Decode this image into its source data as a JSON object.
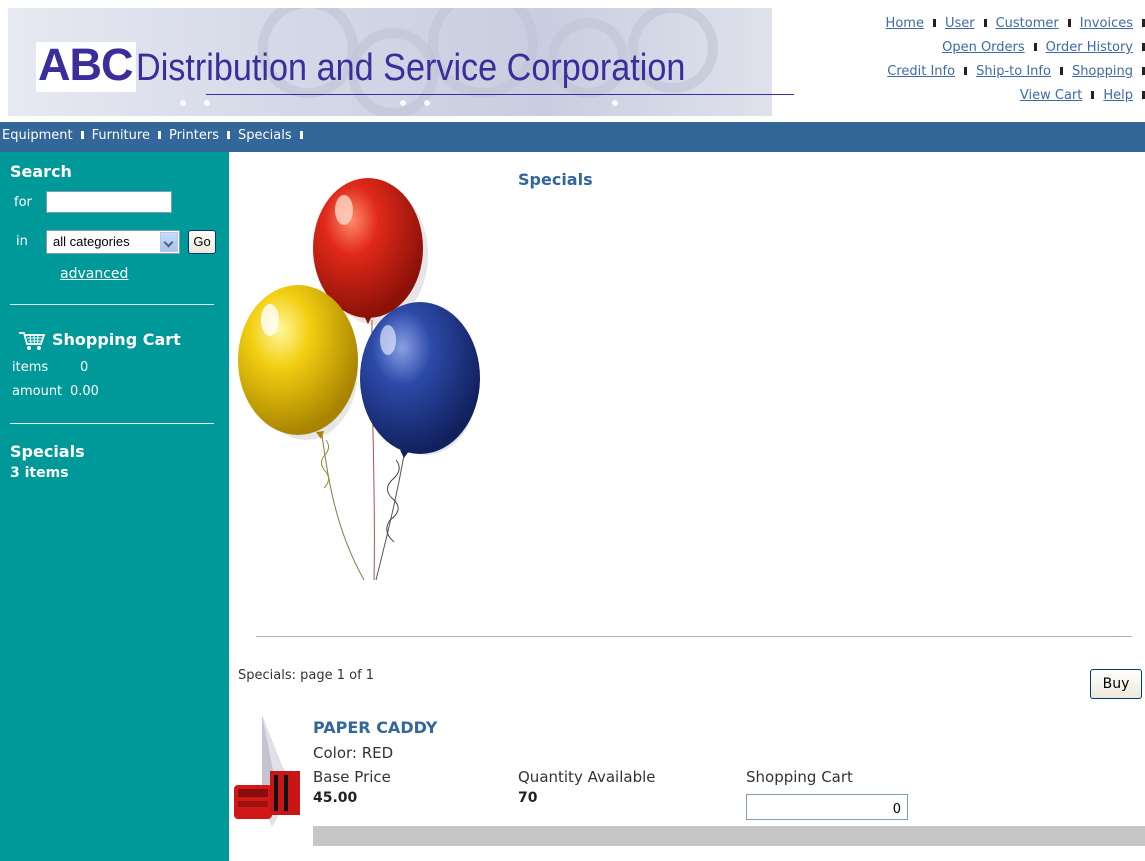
{
  "header": {
    "logo_abc": "ABC",
    "logo_rest": "Distribution and Service Corporation",
    "links": {
      "home": "Home",
      "user": "User",
      "customer": "Customer",
      "invoices": "Invoices",
      "open_orders": "Open Orders",
      "order_history": "Order History",
      "credit_info": "Credit Info",
      "ship_to_info": "Ship-to Info",
      "shopping": "Shopping",
      "view_cart": "View Cart",
      "help": "Help"
    }
  },
  "nav": {
    "equipment": "Equipment",
    "furniture": "Furniture",
    "printers": "Printers",
    "specials": "Specials"
  },
  "sidebar": {
    "search": {
      "title": "Search",
      "for_label": "for",
      "for_value": "",
      "in_label": "in",
      "category_selected": "all categories",
      "go_label": "Go",
      "advanced_label": "advanced"
    },
    "cart": {
      "title": "Shopping Cart",
      "items_label": "items",
      "items_value": "0",
      "amount_label": "amount",
      "amount_value": "0.00"
    },
    "specials": {
      "title": "Specials",
      "count": "3 items"
    }
  },
  "main": {
    "title": "Specials",
    "pagination": "Specials: page 1 of 1",
    "buy_label": "Buy",
    "product": {
      "name": "PAPER CADDY",
      "color": "Color: RED",
      "base_price_label": "Base Price",
      "base_price_value": "45.00",
      "qty_label": "Quantity Available",
      "qty_value": "70",
      "cart_label": "Shopping Cart",
      "cart_value": "0"
    }
  },
  "colors": {
    "nav_bg": "#336699",
    "sidebar_bg": "#009999",
    "link": "#3e6aa8",
    "logo": "#3b2d9b"
  }
}
